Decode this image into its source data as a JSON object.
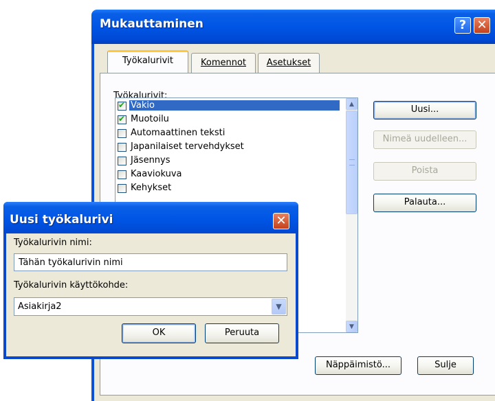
{
  "main_dialog": {
    "title": "Mukauttaminen",
    "help_glyph": "?",
    "close_glyph": "✕",
    "tabs": [
      {
        "label": "Työkalurivit",
        "active": true
      },
      {
        "label": "Komennot",
        "active": false
      },
      {
        "label": "Asetukset",
        "active": false
      }
    ],
    "list_label": "Työkalurivit:",
    "toolbars": [
      {
        "label": "Vakio",
        "checked": true,
        "selected": true
      },
      {
        "label": "Muotoilu",
        "checked": true,
        "selected": false
      },
      {
        "label": "Automaattinen teksti",
        "checked": false,
        "selected": false
      },
      {
        "label": "Japanilaiset tervehdykset",
        "checked": false,
        "selected": false
      },
      {
        "label": "Jäsennys",
        "checked": false,
        "selected": false
      },
      {
        "label": "Kaaviokuva",
        "checked": false,
        "selected": false
      },
      {
        "label": "Kehykset",
        "checked": false,
        "selected": false
      }
    ],
    "buttons": {
      "new": "Uusi...",
      "rename": "Nimeä uudelleen...",
      "delete": "Poista",
      "reset": "Palauta...",
      "keyboard": "Näppäimistö...",
      "close": "Sulje"
    }
  },
  "new_toolbar_dialog": {
    "title": "Uusi työkalurivi",
    "close_glyph": "✕",
    "name_label": "Työkalurivin nimi:",
    "name_value": "Tähän työkalurivin nimi",
    "target_label": "Työkalurivin käyttökohde:",
    "target_value": "Asiakirja2",
    "ok": "OK",
    "cancel": "Peruuta"
  },
  "colors": {
    "title_blue": "#0055e5",
    "dialog_face": "#ece9d8",
    "selection": "#316ac5",
    "tab_highlight": "#ffc83c",
    "close_red": "#c5411c"
  }
}
